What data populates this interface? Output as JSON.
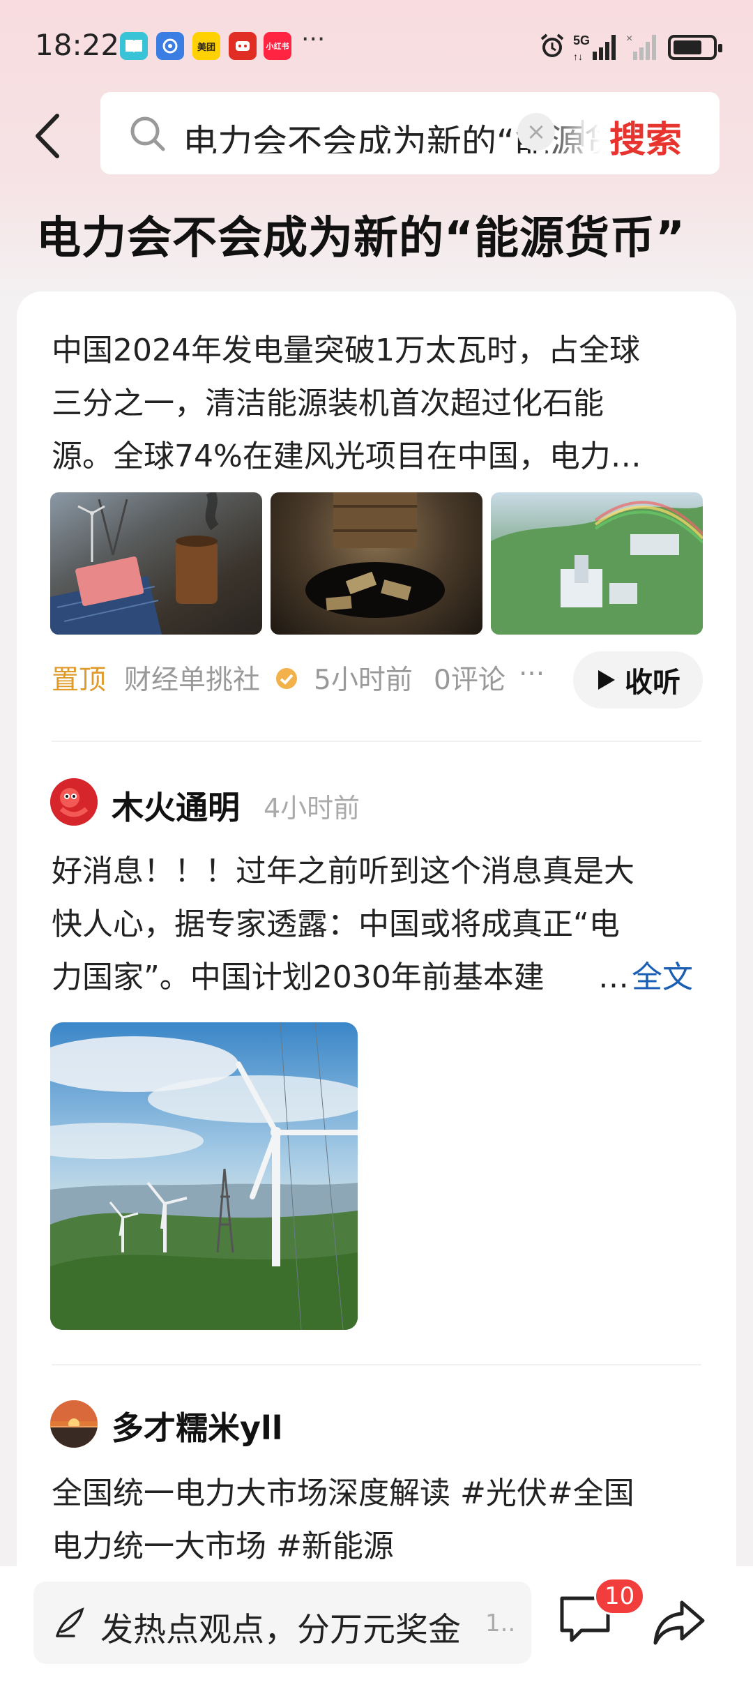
{
  "status_bar": {
    "time": "18:22",
    "apps": [
      "阅读",
      "浏览",
      "美团",
      "拼多多",
      "小红书"
    ],
    "more": "···",
    "network": "5G",
    "battery_percent": 70
  },
  "search": {
    "back_icon": "back-arrow-icon",
    "query": "电力会不会成为新的“能源货币”",
    "clear_icon": "×",
    "submit_label": "搜索"
  },
  "page_title": "电力会不会成为新的“能源货币”",
  "article": {
    "summary": "中国2024年发电量突破1万太瓦时，占全球三分之一，清洁能源装机首次超过化石能源。全球74%在建风光项目在中国，电力…",
    "summary_lines": [
      "中国2024年发电量突破1万太瓦时，占全球",
      "三分之一，清洁能源装机首次超过化石能",
      "源。全球74%在建风光项目在中国，电力…"
    ],
    "images": [
      "solar-oil-money-image",
      "oil-barrel-money-image",
      "hydro-dam-rainbow-image"
    ],
    "pinned_label": "置顶",
    "source": "财经单挑社",
    "time": "5小时前",
    "comments": "0评论",
    "more": "···",
    "listen_label": "收听"
  },
  "post1": {
    "author": "木火通明",
    "time": "4小时前",
    "text_lines": [
      "好消息！！！过年之前听到这个消息真是大",
      "快人心，据专家透露：中国或将成真正“电",
      "力国家”。中国计划2030年前基本建"
    ],
    "ellipsis": "…",
    "full_label": "全文",
    "image": "wind-turbines-mountain-image"
  },
  "post2": {
    "author": "多才糯米yll",
    "text_lines": [
      "全国统一电力大市场深度解读 #光伏#全国",
      "电力统一大市场 #新能源"
    ]
  },
  "bottom_bar": {
    "comment_placeholder": "发热点观点，分万元奖金",
    "comment_count_hint": "1..",
    "comment_badge": "10",
    "comment_icon": "comment-icon",
    "share_icon": "share-icon"
  },
  "colors": {
    "brand_red": "#e8342e",
    "pinned_orange": "#e09a2a",
    "link_blue": "#1a5fb4",
    "badge_red": "#f23d3d"
  }
}
